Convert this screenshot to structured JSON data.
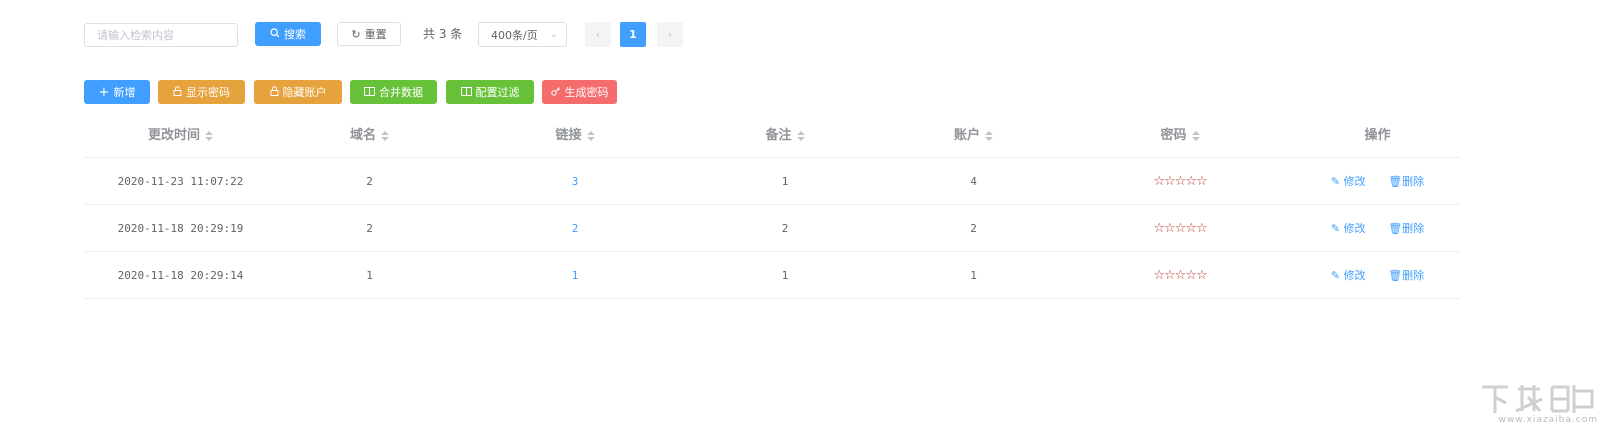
{
  "search": {
    "placeholder": "请输入检索内容",
    "button_label": "搜索",
    "reset_label": "重置"
  },
  "pagination": {
    "total_text": "共 3 条",
    "page_size": "400条/页",
    "current_page": "1",
    "prev": "‹",
    "next": "›"
  },
  "actions": {
    "add": "新增",
    "show_password": "显示密码",
    "hide_account": "隐藏账户",
    "merge_data": "合并数据",
    "config_filter": "配置过滤",
    "generate_password": "生成密码"
  },
  "table": {
    "columns": [
      "更改时间",
      "域名",
      "链接",
      "备注",
      "账户",
      "密码",
      "操作"
    ],
    "rows": [
      {
        "time": "2020-11-23 11:07:22",
        "domain": "2",
        "link": "3",
        "note": "1",
        "account": "4",
        "password": "☆☆☆☆☆"
      },
      {
        "time": "2020-11-18 20:29:19",
        "domain": "2",
        "link": "2",
        "note": "2",
        "account": "2",
        "password": "☆☆☆☆☆"
      },
      {
        "time": "2020-11-18 20:29:14",
        "domain": "1",
        "link": "1",
        "note": "1",
        "account": "1",
        "password": "☆☆☆☆☆"
      }
    ],
    "edit_label": "修改",
    "delete_label": "删除"
  },
  "watermark": {
    "brand": "下载吧",
    "domain": "www.xiazaiba.com"
  }
}
